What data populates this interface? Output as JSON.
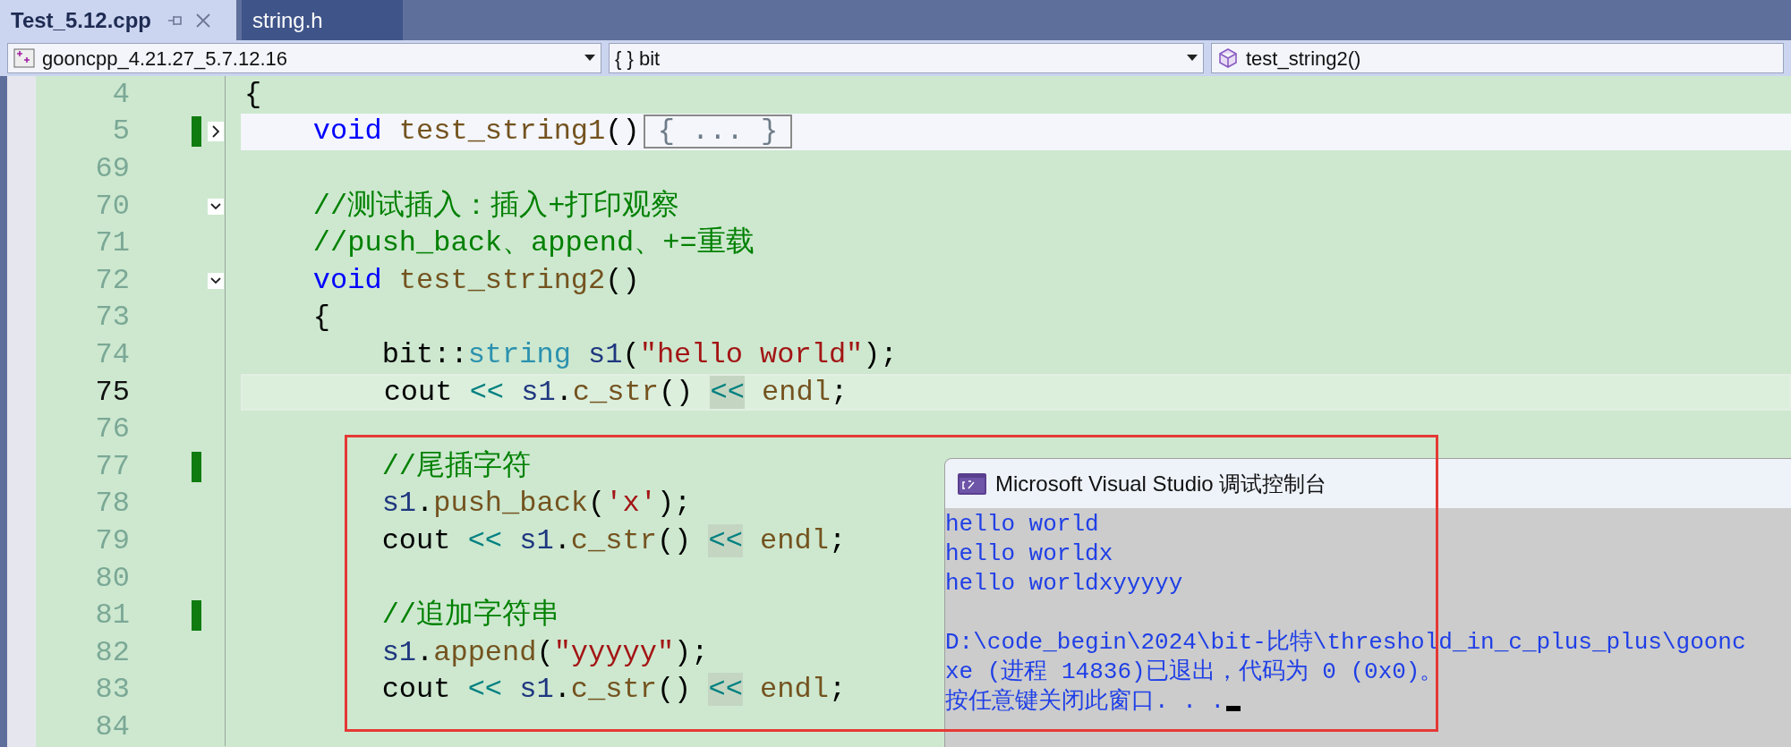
{
  "tabs": [
    {
      "label": "Test_5.12.cpp",
      "selected": true
    },
    {
      "label": "string.h",
      "selected": false
    }
  ],
  "navigation_bar": {
    "project": "gooncpp_4.21.27_5.7.12.16",
    "scope": "{ } bit",
    "member": "test_string2()"
  },
  "code_lines": [
    {
      "number": "4",
      "current": false,
      "highlighted": false,
      "changed": false,
      "tokens": [
        {
          "kind": "plain",
          "text": "{"
        }
      ]
    },
    {
      "number": "5",
      "current": false,
      "highlighted": true,
      "changed": true,
      "collapsed": true,
      "tokens": [
        {
          "kind": "keyword",
          "text": "    void "
        },
        {
          "kind": "function",
          "text": "test_string1"
        },
        {
          "kind": "plain",
          "text": "()"
        }
      ],
      "collapsed_text": "{ ... }"
    },
    {
      "number": "69",
      "current": false,
      "highlighted": false,
      "changed": false
    },
    {
      "number": "70",
      "current": false,
      "highlighted": false,
      "changed": false,
      "collapsed": false,
      "tokens": [
        {
          "kind": "comment",
          "text": "    //测试插入：插入+打印观察"
        }
      ]
    },
    {
      "number": "71",
      "current": false,
      "highlighted": false,
      "changed": false,
      "tokens": [
        {
          "kind": "comment",
          "text": "    //push_back、append、+=重载"
        }
      ]
    },
    {
      "number": "72",
      "current": false,
      "highlighted": false,
      "changed": false,
      "collapsed": false,
      "tokens": [
        {
          "kind": "keyword",
          "text": "    void "
        },
        {
          "kind": "function",
          "text": "test_string2"
        },
        {
          "kind": "plain",
          "text": "()"
        }
      ]
    },
    {
      "number": "73",
      "current": false,
      "highlighted": false,
      "changed": false,
      "tokens": [
        {
          "kind": "plain",
          "text": "    {"
        }
      ]
    },
    {
      "number": "74",
      "current": false,
      "highlighted": false,
      "changed": false,
      "tokens": [
        {
          "kind": "plain",
          "text": "        bit::"
        },
        {
          "kind": "type",
          "text": "string "
        },
        {
          "kind": "variable",
          "text": "s1"
        },
        {
          "kind": "plain",
          "text": "("
        },
        {
          "kind": "string",
          "text": "\"hello world\""
        },
        {
          "kind": "plain",
          "text": ");"
        }
      ]
    },
    {
      "number": "75",
      "current": true,
      "highlighted": false,
      "changed": false,
      "tokens": [
        {
          "kind": "plain",
          "text": "        cout "
        },
        {
          "kind": "operator",
          "text": "<< "
        },
        {
          "kind": "variable",
          "text": "s1"
        },
        {
          "kind": "plain",
          "text": "."
        },
        {
          "kind": "function",
          "text": "c_str"
        },
        {
          "kind": "plain",
          "text": "() "
        },
        {
          "kind": "operator_ref",
          "text": "<<"
        },
        {
          "kind": "function",
          "text": " endl"
        },
        {
          "kind": "plain",
          "text": ";"
        }
      ]
    },
    {
      "number": "76",
      "current": false,
      "highlighted": false,
      "changed": false
    },
    {
      "number": "77",
      "current": false,
      "highlighted": false,
      "changed": true,
      "tokens": [
        {
          "kind": "comment",
          "text": "        //尾插字符"
        }
      ]
    },
    {
      "number": "78",
      "current": false,
      "highlighted": false,
      "changed": false,
      "tokens": [
        {
          "kind": "variable",
          "text": "        s1"
        },
        {
          "kind": "plain",
          "text": "."
        },
        {
          "kind": "function",
          "text": "push_back"
        },
        {
          "kind": "plain",
          "text": "("
        },
        {
          "kind": "string",
          "text": "'x'"
        },
        {
          "kind": "plain",
          "text": ");"
        }
      ]
    },
    {
      "number": "79",
      "current": false,
      "highlighted": false,
      "changed": false,
      "tokens": [
        {
          "kind": "plain",
          "text": "        cout "
        },
        {
          "kind": "operator",
          "text": "<< "
        },
        {
          "kind": "variable",
          "text": "s1"
        },
        {
          "kind": "plain",
          "text": "."
        },
        {
          "kind": "function",
          "text": "c_str"
        },
        {
          "kind": "plain",
          "text": "() "
        },
        {
          "kind": "operator_ref",
          "text": "<<"
        },
        {
          "kind": "function",
          "text": " endl"
        },
        {
          "kind": "plain",
          "text": ";"
        }
      ]
    },
    {
      "number": "80",
      "current": false,
      "highlighted": false,
      "changed": false
    },
    {
      "number": "81",
      "current": false,
      "highlighted": false,
      "changed": true,
      "tokens": [
        {
          "kind": "comment",
          "text": "        //追加字符串"
        }
      ]
    },
    {
      "number": "82",
      "current": false,
      "highlighted": false,
      "changed": false,
      "tokens": [
        {
          "kind": "variable",
          "text": "        s1"
        },
        {
          "kind": "plain",
          "text": "."
        },
        {
          "kind": "function",
          "text": "append"
        },
        {
          "kind": "plain",
          "text": "("
        },
        {
          "kind": "string",
          "text": "\"yyyyy\""
        },
        {
          "kind": "plain",
          "text": ");"
        }
      ]
    },
    {
      "number": "83",
      "current": false,
      "highlighted": false,
      "changed": false,
      "tokens": [
        {
          "kind": "plain",
          "text": "        cout "
        },
        {
          "kind": "operator",
          "text": "<< "
        },
        {
          "kind": "variable",
          "text": "s1"
        },
        {
          "kind": "plain",
          "text": "."
        },
        {
          "kind": "function",
          "text": "c_str"
        },
        {
          "kind": "plain",
          "text": "() "
        },
        {
          "kind": "operator_ref",
          "text": "<<"
        },
        {
          "kind": "function",
          "text": " endl"
        },
        {
          "kind": "plain",
          "text": ";"
        }
      ]
    },
    {
      "number": "84",
      "current": false,
      "highlighted": false,
      "changed": false
    }
  ],
  "console": {
    "title": "Microsoft Visual Studio 调试控制台",
    "output": [
      "hello world",
      "hello worldx",
      "hello worldxyyyyy"
    ],
    "exit_message": [
      "D:\\code_begin\\2024\\bit-比特\\threshold_in_c_plus_plus\\goonc",
      "xe (进程 14836)已退出，代码为 0 (0x0)。",
      "按任意键关闭此窗口. . ."
    ],
    "cursor": true
  }
}
